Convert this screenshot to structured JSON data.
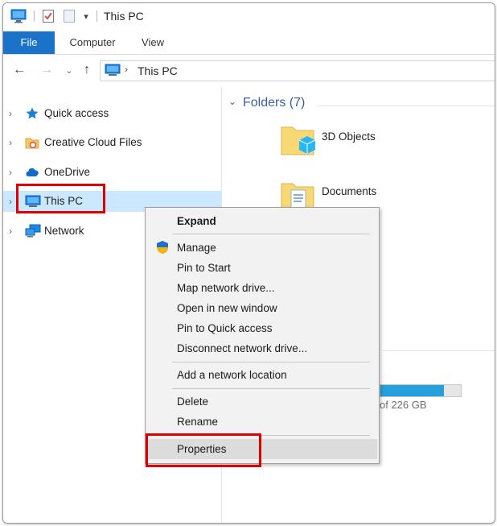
{
  "window": {
    "title": "This PC"
  },
  "ribbon": {
    "tabs": [
      "File",
      "Computer",
      "View"
    ]
  },
  "address": {
    "location": "This PC"
  },
  "nav": {
    "items": [
      {
        "label": "Quick access",
        "icon": "star-icon"
      },
      {
        "label": "Creative Cloud Files",
        "icon": "creative-cloud-folder-icon"
      },
      {
        "label": "OneDrive",
        "icon": "onedrive-cloud-icon"
      },
      {
        "label": "This PC",
        "icon": "computer-icon",
        "selected": true
      },
      {
        "label": "Network",
        "icon": "network-icon"
      }
    ]
  },
  "content": {
    "group_title": "Folders (7)",
    "folders": [
      {
        "label": "3D Objects",
        "icon": "3d-objects-folder-icon"
      },
      {
        "label": "Documents",
        "icon": "documents-folder-icon"
      }
    ],
    "drive": {
      "size_text": "of 226 GB",
      "used_fraction": 0.79
    }
  },
  "context_menu": {
    "items": [
      {
        "label": "Expand",
        "bold": true
      },
      {
        "label": "Manage",
        "icon": "uac-shield-icon"
      },
      {
        "label": "Pin to Start"
      },
      {
        "label": "Map network drive..."
      },
      {
        "label": "Open in new window"
      },
      {
        "label": "Pin to Quick access"
      },
      {
        "label": "Disconnect network drive..."
      },
      {
        "label": "Add a network location"
      },
      {
        "label": "Delete"
      },
      {
        "label": "Rename"
      },
      {
        "label": "Properties",
        "highlighted": true
      }
    ]
  },
  "colors": {
    "file_tab": "#1a73c8",
    "selection": "#cce8ff",
    "highlight_box": "#e00000",
    "group_heading": "#3a5fa8"
  }
}
